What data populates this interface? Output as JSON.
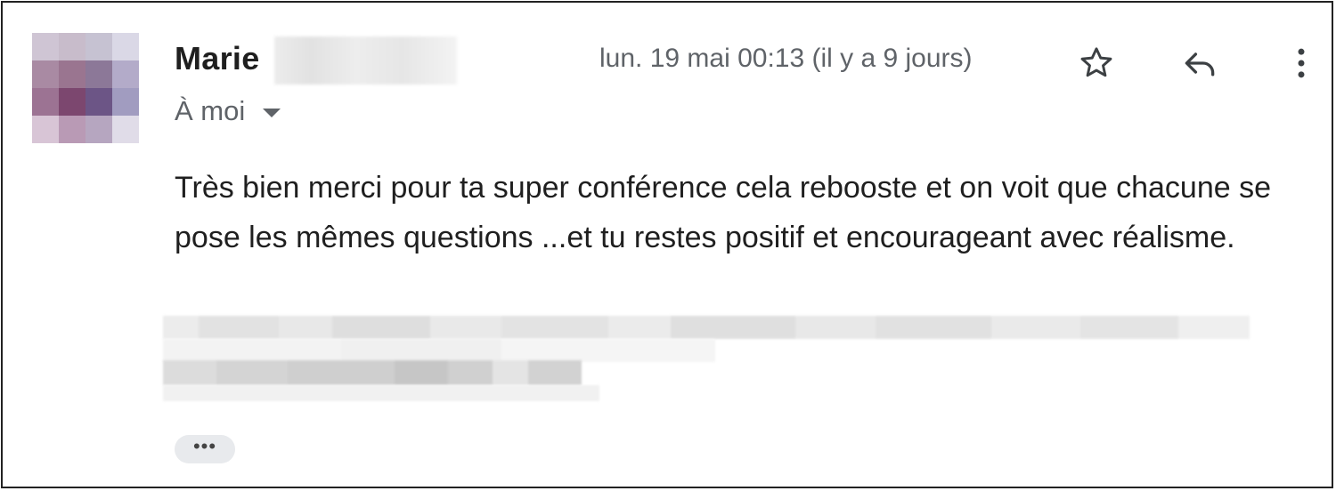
{
  "email": {
    "sender_name": "Marie",
    "recipient_label": "À moi",
    "date": "lun. 19 mai 00:13 (il y a 9 jours)",
    "body": "Très bien merci pour ta super conférence cela rebooste et on voit que chacune se pose les mêmes questions ...et tu restes positif et encourageant avec réalisme.",
    "show_trimmed_label": "•••"
  },
  "icons": {
    "star": "star-icon",
    "reply": "reply-icon",
    "more": "more-vert-icon",
    "caret": "chevron-down-icon"
  },
  "colors": {
    "text_primary": "#1f1f1f",
    "text_secondary": "#5f6368",
    "pill_bg": "#e8eaed"
  }
}
